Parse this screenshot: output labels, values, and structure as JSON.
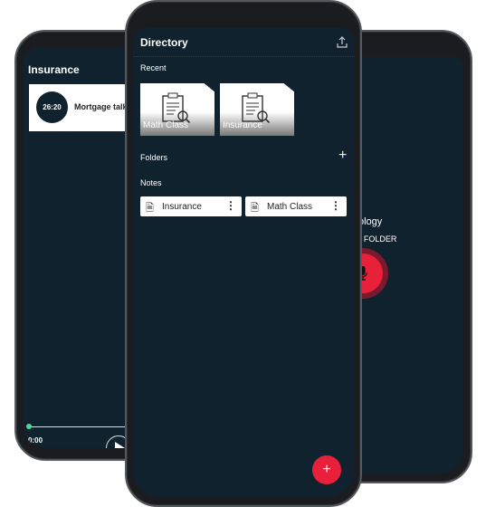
{
  "left_screen": {
    "title": "Insurance",
    "recording": {
      "duration": "26:20",
      "name": "Mortgage talk"
    },
    "player": {
      "time": "0:00",
      "progress": 0
    }
  },
  "right_screen": {
    "title_partial": "ology",
    "folder_partial": "T FOLDER",
    "mic_color": "#e8203a"
  },
  "center_screen": {
    "title": "Directory",
    "recent_label": "Recent",
    "recent": [
      {
        "label": "Math Class"
      },
      {
        "label": "Insurance"
      }
    ],
    "folders_label": "Folders",
    "notes_label": "Notes",
    "notes": [
      {
        "label": "Insurance"
      },
      {
        "label": "Math Class"
      }
    ]
  },
  "colors": {
    "background": "#11222f",
    "accent": "#e8203a",
    "progress": "#4fd69c"
  }
}
